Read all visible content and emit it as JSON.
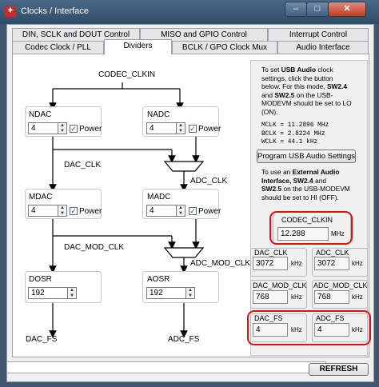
{
  "window": {
    "title": "Clocks / Interface",
    "min": "–",
    "max": "□",
    "close": "✕"
  },
  "tabs_row1": [
    "DIN, SCLK and DOUT Control",
    "MISO and GPIO Control",
    "Interrupt Control"
  ],
  "tabs_row2": [
    "Codec Clock / PLL",
    "Dividers",
    "BCLK / GPO Clock Mux",
    "Audio Interface"
  ],
  "diagram": {
    "codec_clkin": "CODEC_CLKIN",
    "ndac": {
      "label": "NDAC",
      "value": "4",
      "power": "Power"
    },
    "nadc": {
      "label": "NADC",
      "value": "4",
      "power": "Power"
    },
    "dac_clk": "DAC_CLK",
    "adc_clk": "ADC_CLK",
    "mdac": {
      "label": "MDAC",
      "value": "4",
      "power": "Power"
    },
    "madc": {
      "label": "MADC",
      "value": "4",
      "power": "Power"
    },
    "dac_mod_clk": "DAC_MOD_CLK",
    "adc_mod_clk": "ADC_MOD_CLK",
    "dosr": {
      "label": "DOSR",
      "value": "192"
    },
    "aosr": {
      "label": "AOSR",
      "value": "192"
    },
    "dac_fs": "DAC_FS",
    "adc_fs": "ADC_FS"
  },
  "panel": {
    "usb_note_1": "To set ",
    "usb_note_b1": "USB Audio",
    "usb_note_2": " clock",
    "usb_note_3": "settings, click the button",
    "usb_note_4": "below. For this mode, ",
    "usb_note_b2": "SW2.4",
    "usb_note_5": "and ",
    "usb_note_b3": "SW2.5",
    "usb_note_6": " on the USB-",
    "usb_note_7": "MODEVM should be set to LO",
    "usb_note_8": "(ON).",
    "mclk": "MCLK = 11.2896 MHz",
    "bclk": "BCLK = 2.8224 MHz",
    "wclk": "WCLK = 44.1 kHz",
    "usb_button": "Program USB Audio Settings",
    "ext_note_1": "To use an ",
    "ext_note_b1": "External Audio",
    "ext_note_b2": "Interface, SW2.4",
    "ext_note_2": " and",
    "ext_note_b3": "SW2.5",
    "ext_note_3": " on the USB-MODEVM",
    "ext_note_4": "should be set to HI (OFF).",
    "codec_clkin": {
      "label": "CODEC_CLKIN",
      "value": "12.288",
      "unit": "MHz"
    },
    "dac_clk": {
      "label": "DAC_CLK",
      "value": "3072",
      "unit": "kHz"
    },
    "adc_clk": {
      "label": "ADC_CLK",
      "value": "3072",
      "unit": "kHz"
    },
    "dac_mod_clk": {
      "label": "DAC_MOD_CLK",
      "value": "768",
      "unit": "kHz"
    },
    "adc_mod_clk": {
      "label": "ADC_MOD_CLK",
      "value": "768",
      "unit": "kHz"
    },
    "dac_fs": {
      "label": "DAC_FS",
      "value": "4",
      "unit": "kHz"
    },
    "adc_fs": {
      "label": "ADC_FS",
      "value": "4",
      "unit": "kHz"
    }
  },
  "footer": {
    "status": "",
    "refresh": "REFRESH"
  }
}
